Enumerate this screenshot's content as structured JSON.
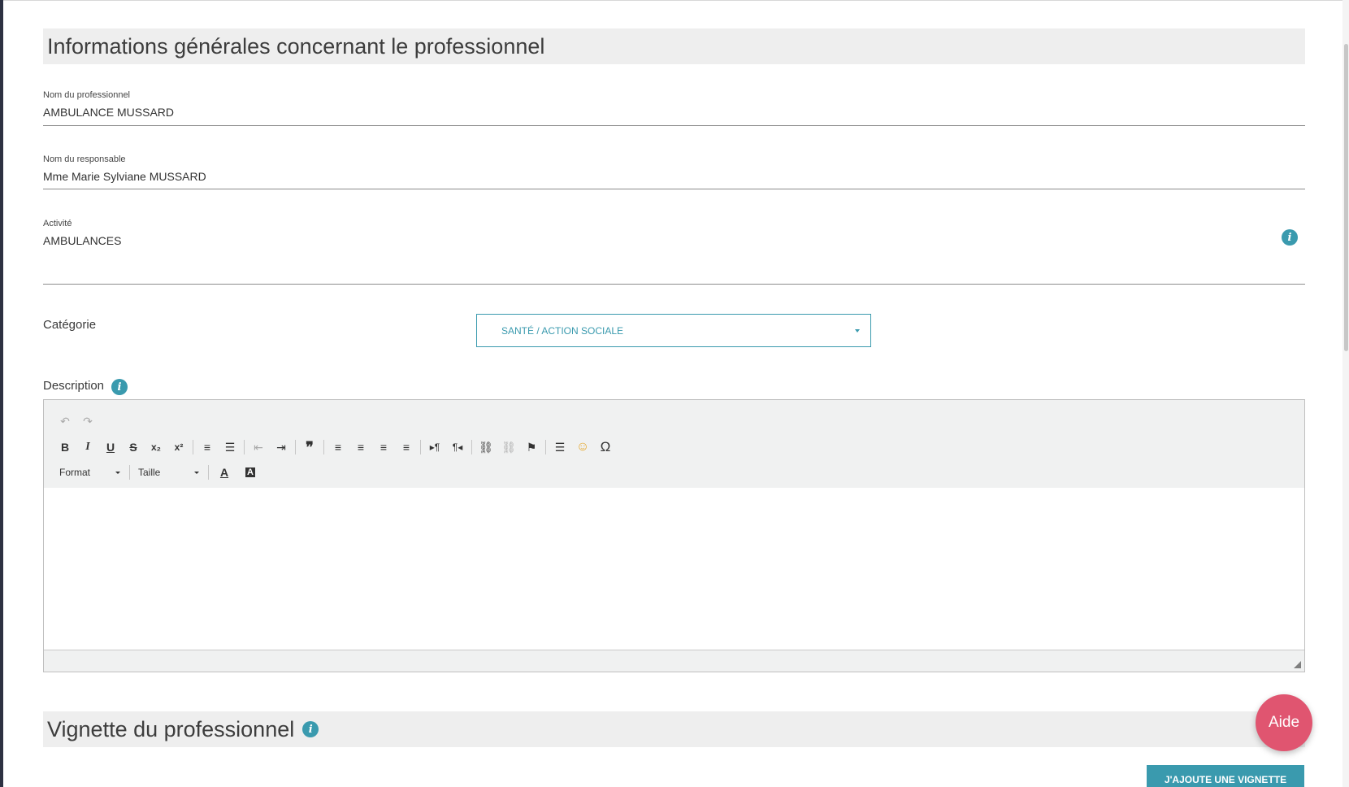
{
  "general_section": {
    "title": "Informations générales concernant le professionnel"
  },
  "fields": {
    "nom_pro": {
      "label": "Nom du professionnel",
      "value": "AMBULANCE MUSSARD"
    },
    "nom_resp": {
      "label": "Nom du responsable",
      "value": "Mme Marie Sylviane MUSSARD"
    },
    "activite": {
      "label": "Activité",
      "value": "AMBULANCES"
    }
  },
  "categorie": {
    "label": "Catégorie",
    "selected": "SANTÉ / ACTION SOCIALE"
  },
  "description": {
    "label": "Description",
    "toolbar": {
      "format_label": "Format",
      "size_label": "Taille",
      "glyphs": {
        "undo": "↶",
        "redo": "↷",
        "bold": "B",
        "italic": "I",
        "underline": "U",
        "strike": "S",
        "subscript": "x₂",
        "superscript": "x²",
        "numbered_list": "≡",
        "bullet_list": "☰",
        "outdent": "⇤",
        "indent": "⇥",
        "blockquote": "❞",
        "align_left": "≡",
        "align_center": "≡",
        "align_right": "≡",
        "align_justify": "≡",
        "ltr": "▸¶",
        "rtl": "¶◂",
        "link": "⛓",
        "unlink": "⛓",
        "anchor": "⚑",
        "hr": "☰",
        "emoji": "☺",
        "special_char": "Ω",
        "text_color": "A",
        "bg_color": "A"
      }
    }
  },
  "vignette_section": {
    "title": "Vignette du professionnel"
  },
  "buttons": {
    "aide": "Aide",
    "add_vignette": "J'AJOUTE UNE VIGNETTE"
  },
  "icons": {
    "info": "i"
  },
  "colors": {
    "accent": "#3a9aae",
    "aide": "#e05570",
    "section_bg": "#eeeeee"
  }
}
